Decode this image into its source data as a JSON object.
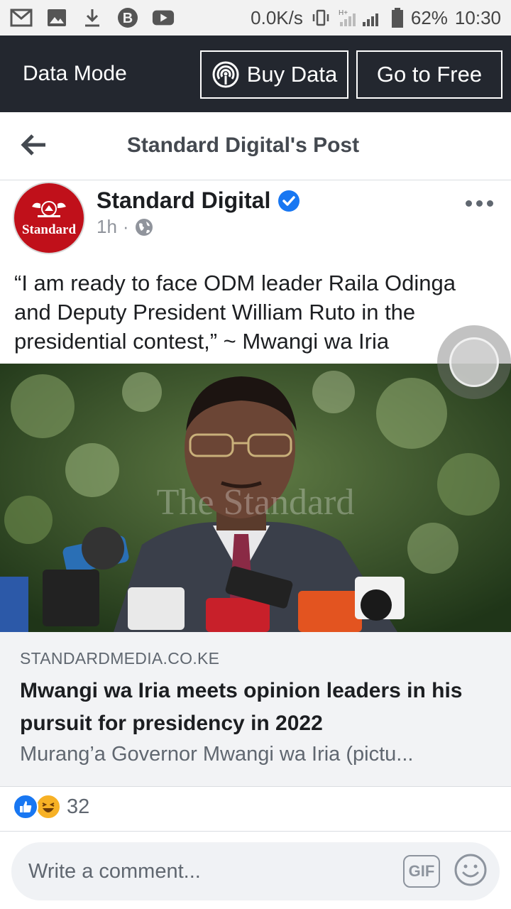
{
  "status_bar": {
    "icons": [
      "gmail-icon",
      "gallery-icon",
      "download-icon",
      "bitcoin-icon",
      "youtube-icon"
    ],
    "speed": "0.0K/s",
    "battery": "62%",
    "time": "10:30"
  },
  "data_bar": {
    "label": "Data Mode",
    "buy_label": "Buy Data",
    "free_label": "Go to Free"
  },
  "header": {
    "title": "Standard Digital's Post"
  },
  "post": {
    "author": "Standard Digital",
    "avatar_text": "Standard",
    "time": "1h",
    "separator": "·",
    "text": "“I am ready to face ODM leader Raila Odinga and Deputy President William Ruto in the presidential contest,” ~ Mwangi wa Iria",
    "photo_watermark": "The Standard"
  },
  "link": {
    "domain": "STANDARDMEDIA.CO.KE",
    "title": "Mwangi wa Iria meets opinion leaders in his pursuit for presidency in 2022",
    "description": "Murang’a Governor Mwangi wa Iria  (pictu..."
  },
  "reactions": {
    "count": "32"
  },
  "comment": {
    "placeholder": "Write a comment...",
    "gif_label": "GIF"
  },
  "colors": {
    "data_bar": "#23272f",
    "brand_red": "#c0101a",
    "facebook_blue": "#1877f2"
  }
}
